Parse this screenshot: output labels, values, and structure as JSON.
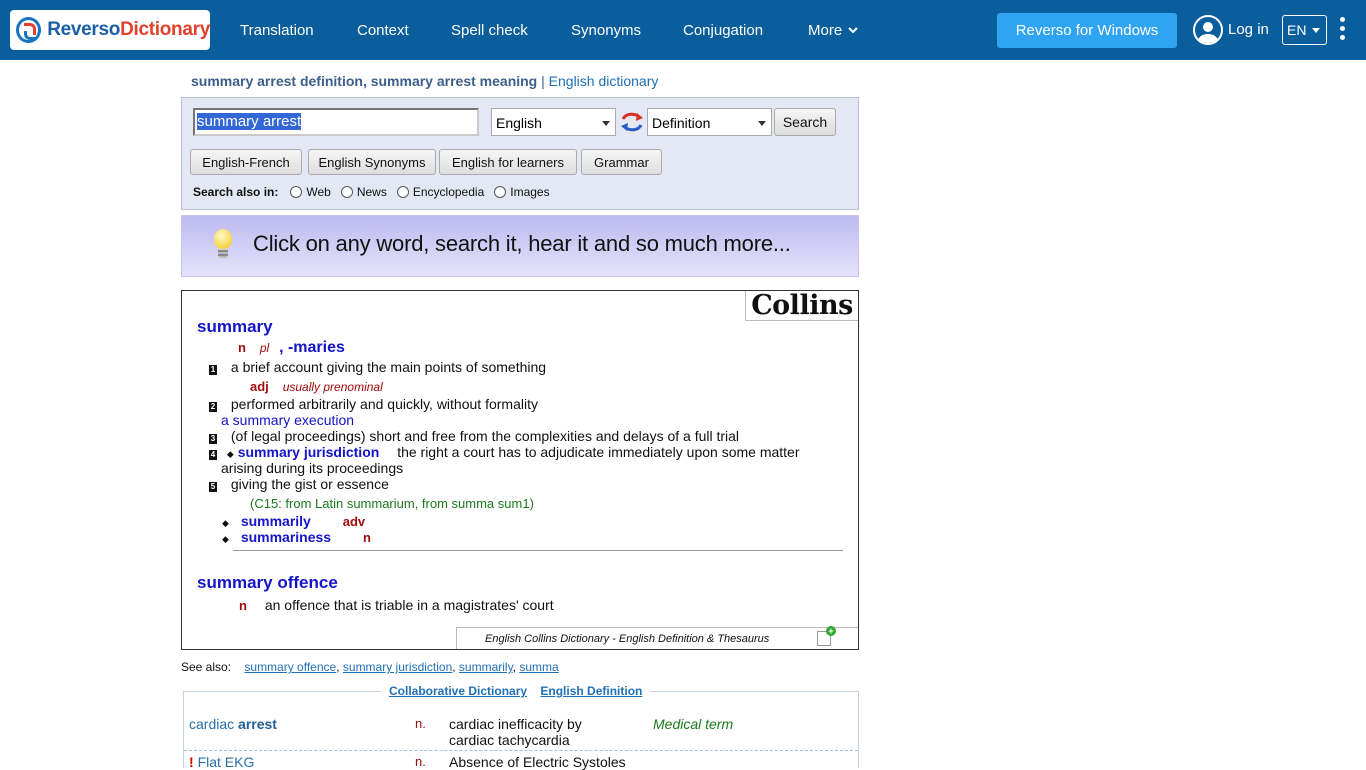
{
  "header": {
    "logo_part1": "Reverso",
    "logo_part2": "Dictionary",
    "nav": [
      "Translation",
      "Context",
      "Spell check",
      "Synonyms",
      "Conjugation",
      "More"
    ],
    "windows_button": "Reverso for Windows",
    "login": "Log in",
    "language": "EN"
  },
  "page": {
    "title_bold": "summary arrest definition, summary arrest meaning",
    "title_sep": "|",
    "title_link": "English dictionary"
  },
  "search": {
    "query": "summary arrest",
    "source_lang": "English",
    "mode": "Definition",
    "search_button": "Search",
    "tabs": [
      "English-French",
      "English Synonyms",
      "English for learners",
      "Grammar"
    ],
    "also_label": "Search also in:",
    "also_options": [
      "Web",
      "News",
      "Encyclopedia",
      "Images"
    ]
  },
  "banner": {
    "text": "Click on any word,  search it,  hear it  and so much more..."
  },
  "collins": {
    "logo": "Collins",
    "entry1": {
      "headword": "summary",
      "pos": "n",
      "plural_label": "pl",
      "plural": ", -maries",
      "sense1": "a brief account giving the main points of something",
      "adj_pos": "adj",
      "adj_gram": "usually prenominal",
      "sense2": "performed arbitrarily and quickly, without formality",
      "example2": "a summary execution",
      "sense3": "(of legal proceedings) short and free from the complexities and delays of a full trial",
      "sense4_term": "summary jurisdiction",
      "sense4_line1": "the right a court has to adjudicate immediately upon some matter",
      "sense4_line2": "arising during its proceedings",
      "sense5": "giving the gist or essence",
      "etymology": "(C15: from Latin summarium, from summa sum1)",
      "derived1": "summarily",
      "derived1_pos": "adv",
      "derived2": "summariness",
      "derived2_pos": "n",
      "nums": [
        "1",
        "2",
        "3",
        "4",
        "5"
      ]
    },
    "entry2": {
      "headword": "summary offence",
      "pos": "n",
      "sense": "an offence that is triable in a magistrates' court"
    },
    "footer": "English Collins Dictionary - English Definition & Thesaurus"
  },
  "see_also": {
    "label": "See also:",
    "links": [
      "summary offence",
      "summary jurisdiction",
      "summarily",
      "summa"
    ]
  },
  "collab": {
    "title_a": "Collaborative Dictionary",
    "title_b": "English Definition",
    "rows": [
      {
        "prefix": "",
        "term_a": "cardiac ",
        "term_b": "arrest",
        "pos": "n.",
        "def_line1": "cardiac inefficacity by",
        "def_line2": "cardiac tachycardia",
        "domain": "Medical term"
      },
      {
        "prefix": "!",
        "term_a": "Flat EKG",
        "term_b": "",
        "pos": "n.",
        "def_line1": "Absence of Electric Systoles",
        "def_line2": "",
        "domain": ""
      }
    ]
  },
  "colors": {
    "topbar": "#0a5e9c",
    "accent_button": "#2ea4f2",
    "headword": "#1414c8",
    "pos": "#a10b0b"
  }
}
